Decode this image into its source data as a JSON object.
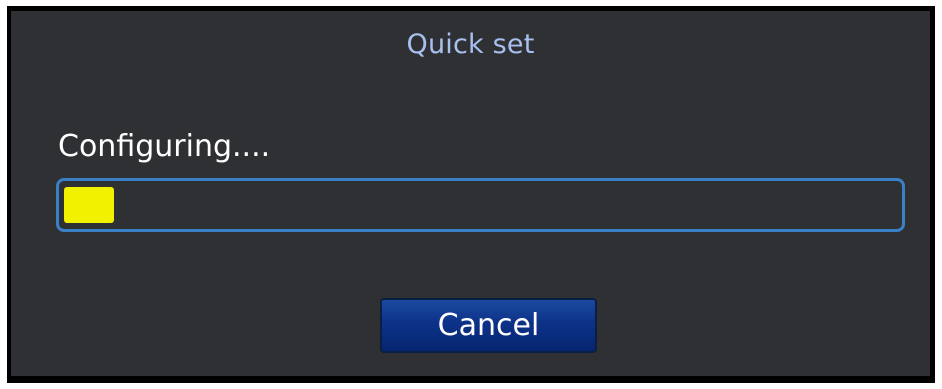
{
  "dialog": {
    "title": "Quick set",
    "status_text": "Configuring....",
    "progress": {
      "value_fraction": 0.06,
      "fill_color": "#f2f200",
      "border_color": "#3b7fc6"
    },
    "cancel_label": "Cancel"
  },
  "colors": {
    "background": "#2f3034",
    "title": "#a8c0ee",
    "button": "#0c3288"
  }
}
